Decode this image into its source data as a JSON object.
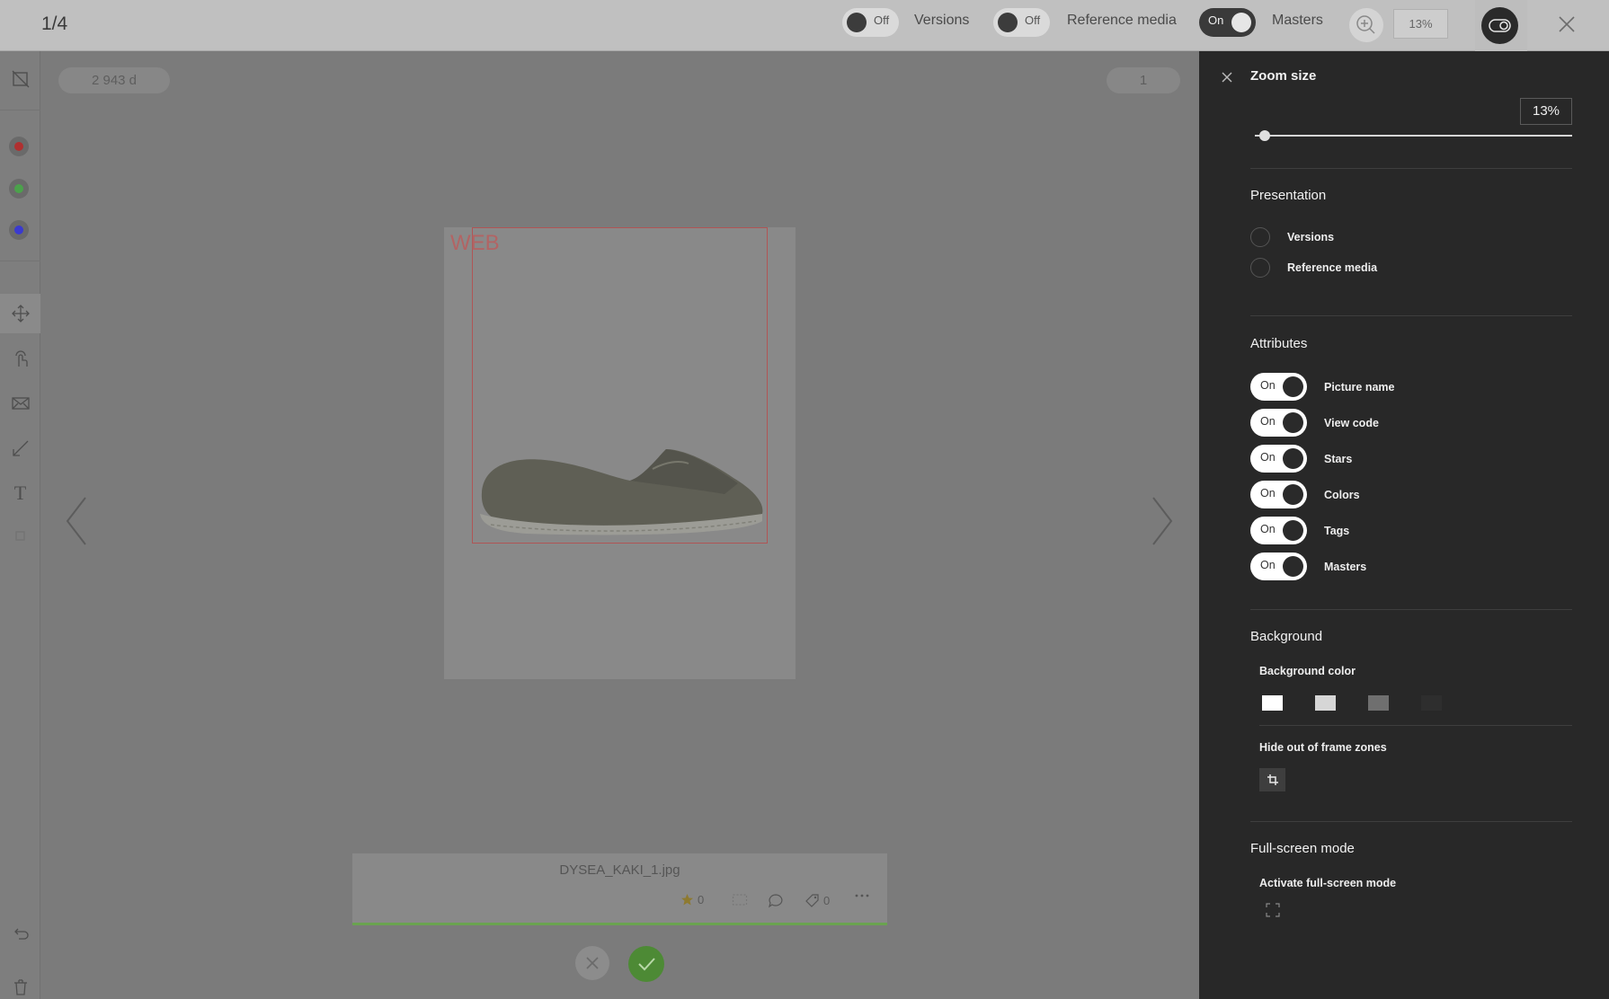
{
  "topbar": {
    "counter": "1/4",
    "toggles": [
      {
        "state": "Off",
        "label": "Versions"
      },
      {
        "state": "Off",
        "label": "Reference media"
      },
      {
        "state": "On",
        "label": "Masters"
      }
    ],
    "zoom_value": "13%"
  },
  "stage": {
    "duration": "2 943 d",
    "page_badge": "1",
    "frame_label": "WEB",
    "file_name": "DYSEA_KAKI_1.jpg",
    "stars_count": "0",
    "tags_count": "0"
  },
  "panel": {
    "zoom_title": "Zoom size",
    "zoom_value": "13%",
    "zoom_level": 0.03,
    "presentation_title": "Presentation",
    "presentation_options": [
      "Versions",
      "Reference media"
    ],
    "attributes_title": "Attributes",
    "attributes": [
      {
        "state": "On",
        "label": "Picture name"
      },
      {
        "state": "On",
        "label": "View code"
      },
      {
        "state": "On",
        "label": "Stars"
      },
      {
        "state": "On",
        "label": "Colors"
      },
      {
        "state": "On",
        "label": "Tags"
      },
      {
        "state": "On",
        "label": "Masters"
      }
    ],
    "background_title": "Background",
    "background_color_label": "Background color",
    "background_colors": [
      "#ffffff",
      "#d6d6d6",
      "#6f6f6f",
      "#2e2e2e"
    ],
    "hide_zones_label": "Hide out of frame zones",
    "fullscreen_title": "Full-screen mode",
    "fullscreen_label": "Activate full-screen mode"
  },
  "colors": {
    "annotation_red": "#b03030",
    "annotation_green": "#4ba24b",
    "annotation_blue": "#3a3acf",
    "accept_green": "#4d8a35"
  },
  "icons": [
    "hide-annotations-icon",
    "move-icon",
    "touch-icon",
    "envelope-icon",
    "arrow-tool-icon",
    "text-tool-icon",
    "undo-icon",
    "trash-icon",
    "zoom-in-icon",
    "compare-toggle-icon",
    "close-icon",
    "chevron-left-icon",
    "chevron-right-icon",
    "star-icon",
    "frame-icon",
    "comment-icon",
    "tag-icon",
    "more-icon",
    "reject-icon",
    "accept-icon",
    "crop-icon",
    "fullscreen-icon"
  ]
}
